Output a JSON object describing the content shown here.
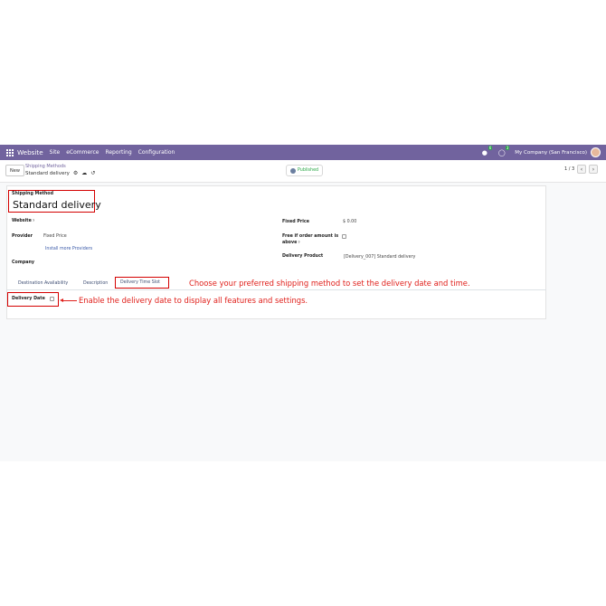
{
  "navbar": {
    "brand": "Website",
    "items": [
      "Site",
      "eCommerce",
      "Reporting",
      "Configuration"
    ],
    "chat_badge": "6",
    "activity_badge": "3",
    "company": "My Company (San Francisco)"
  },
  "control_panel": {
    "new_label": "New",
    "breadcrumb": "Shipping Methods",
    "record_name": "Standard delivery",
    "published_label": "Published",
    "pager": "1 / 3"
  },
  "form": {
    "shipping_method_label": "Shipping Method",
    "shipping_method_value": "Standard delivery",
    "website_label": "Website",
    "provider_label": "Provider",
    "provider_value": "Fixed Price",
    "install_link": "Install more Providers",
    "company_label": "Company",
    "fixed_price_label": "Fixed Price",
    "fixed_price_value": "$ 0.00",
    "free_label_line1": "Free if order amount is",
    "free_label_line2": "above",
    "delivery_product_label": "Delivery Product",
    "delivery_product_value": "[Delivery_007] Standard delivery"
  },
  "tabs": [
    "Destination Availability",
    "Description",
    "Delivery Time Slot"
  ],
  "delivery_date_label": "Delivery Date",
  "annotations": {
    "tab_note": "Choose your preferred shipping method to set the delivery date and time.",
    "checkbox_note": "Enable the delivery date to display all features and settings."
  },
  "colors": {
    "navbar": "#71639e",
    "annotation": "#e0201b",
    "published": "#28a745"
  }
}
